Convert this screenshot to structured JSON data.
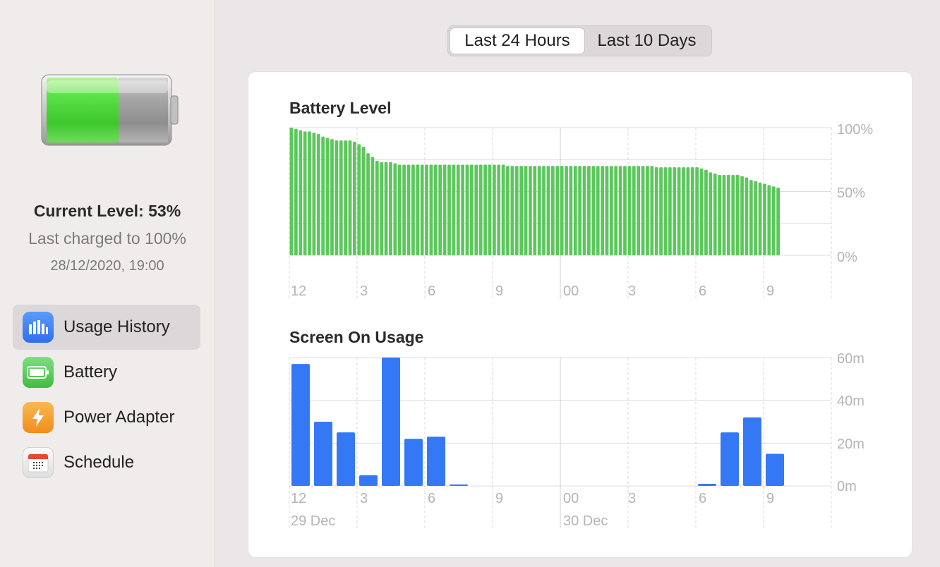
{
  "sidebar": {
    "battery_icon": "battery-large-icon",
    "current_level": "Current Level: 53%",
    "last_charged": "Last charged to 100%",
    "charged_date": "28/12/2020, 19:00",
    "items": [
      {
        "label": "Usage History",
        "icon": "usage-history-icon",
        "color": "#3b7ff5",
        "active": true
      },
      {
        "label": "Battery",
        "icon": "battery-icon",
        "color": "#5fcf5f",
        "active": false
      },
      {
        "label": "Power Adapter",
        "icon": "power-adapter-icon",
        "color": "#f5a030",
        "active": false
      },
      {
        "label": "Schedule",
        "icon": "schedule-icon",
        "color": "#e8e8e8",
        "active": false
      }
    ]
  },
  "segment": {
    "options": [
      "Last 24 Hours",
      "Last 10 Days"
    ],
    "selected": "Last 24 Hours"
  },
  "colors": {
    "battery_bar": "#5cc75c",
    "screen_bar": "#3478f6",
    "grid": "#dddddd",
    "axis_label": "#b5b5b5"
  },
  "chart_data": [
    {
      "type": "bar",
      "title": "Battery Level",
      "ylim": [
        0,
        100
      ],
      "y_ticks": [
        "100%",
        "50%",
        "0%"
      ],
      "x_tick_labels": [
        "12",
        "3",
        "6",
        "9",
        "00",
        "3",
        "6",
        "9"
      ],
      "values": [
        100,
        99,
        98,
        97,
        97,
        96,
        95,
        93,
        92,
        91,
        90,
        90,
        90,
        90,
        89,
        87,
        85,
        80,
        77,
        74,
        73,
        73,
        73,
        72,
        71,
        71,
        71,
        71,
        71,
        71,
        71,
        71,
        71,
        71,
        71,
        71,
        71,
        71,
        71,
        71,
        71,
        71,
        71,
        71,
        71,
        71,
        71,
        71,
        70,
        70,
        70,
        70,
        70,
        70,
        70,
        70,
        70,
        70,
        70,
        70,
        70,
        70,
        70,
        70,
        70,
        70,
        70,
        70,
        70,
        70,
        70,
        70,
        70,
        70,
        70,
        70,
        70,
        70,
        70,
        70,
        70,
        69,
        69,
        69,
        69,
        69,
        69,
        69,
        69,
        69,
        69,
        68,
        67,
        65,
        64,
        63,
        63,
        63,
        63,
        63,
        62,
        61,
        59,
        58,
        57,
        56,
        55,
        54,
        53
      ]
    },
    {
      "type": "bar",
      "title": "Screen On Usage",
      "ylim": [
        0,
        60
      ],
      "y_ticks": [
        "60m",
        "40m",
        "20m",
        "0m"
      ],
      "x_tick_labels": [
        "12",
        "3",
        "6",
        "9",
        "00",
        "3",
        "6",
        "9"
      ],
      "date_labels": [
        "29 Dec",
        "30 Dec"
      ],
      "values": [
        57,
        30,
        25,
        5,
        60,
        22,
        23,
        0.5,
        0,
        0,
        0,
        0,
        0,
        0,
        0,
        0,
        0,
        0,
        1,
        25,
        32,
        15
      ]
    }
  ]
}
